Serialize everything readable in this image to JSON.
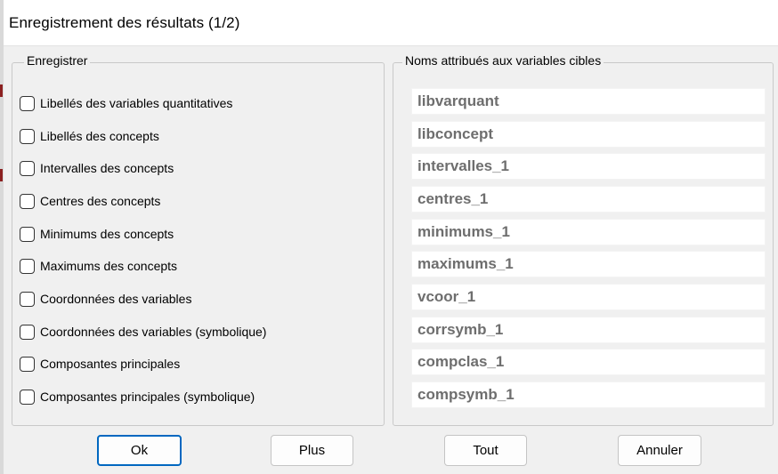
{
  "window": {
    "title": "Enregistrement des résultats (1/2)"
  },
  "groups": {
    "left_title": "Enregistrer",
    "right_title": "Noms attribués aux variables cibles"
  },
  "options": [
    {
      "label": "Libellés des variables quantitatives",
      "checked": false,
      "target": "libvarquant"
    },
    {
      "label": "Libellés des concepts",
      "checked": false,
      "target": "libconcept"
    },
    {
      "label": "Intervalles des concepts",
      "checked": false,
      "target": "intervalles_1"
    },
    {
      "label": "Centres des concepts",
      "checked": false,
      "target": "centres_1"
    },
    {
      "label": "Minimums des concepts",
      "checked": false,
      "target": "minimums_1"
    },
    {
      "label": "Maximums des concepts",
      "checked": false,
      "target": "maximums_1"
    },
    {
      "label": "Coordonnées des variables",
      "checked": false,
      "target": "vcoor_1"
    },
    {
      "label": "Coordonnées des variables (symbolique)",
      "checked": false,
      "target": "corrsymb_1"
    },
    {
      "label": "Composantes principales",
      "checked": false,
      "target": "compclas_1"
    },
    {
      "label": "Composantes principales (symbolique)",
      "checked": false,
      "target": "compsymb_1"
    }
  ],
  "buttons": {
    "ok": "Ok",
    "plus": "Plus",
    "tout": "Tout",
    "annuler": "Annuler"
  },
  "colors": {
    "accent": "#0067c0",
    "dialog_bg": "#f0f0f0",
    "field_text": "#6e6e6e"
  }
}
